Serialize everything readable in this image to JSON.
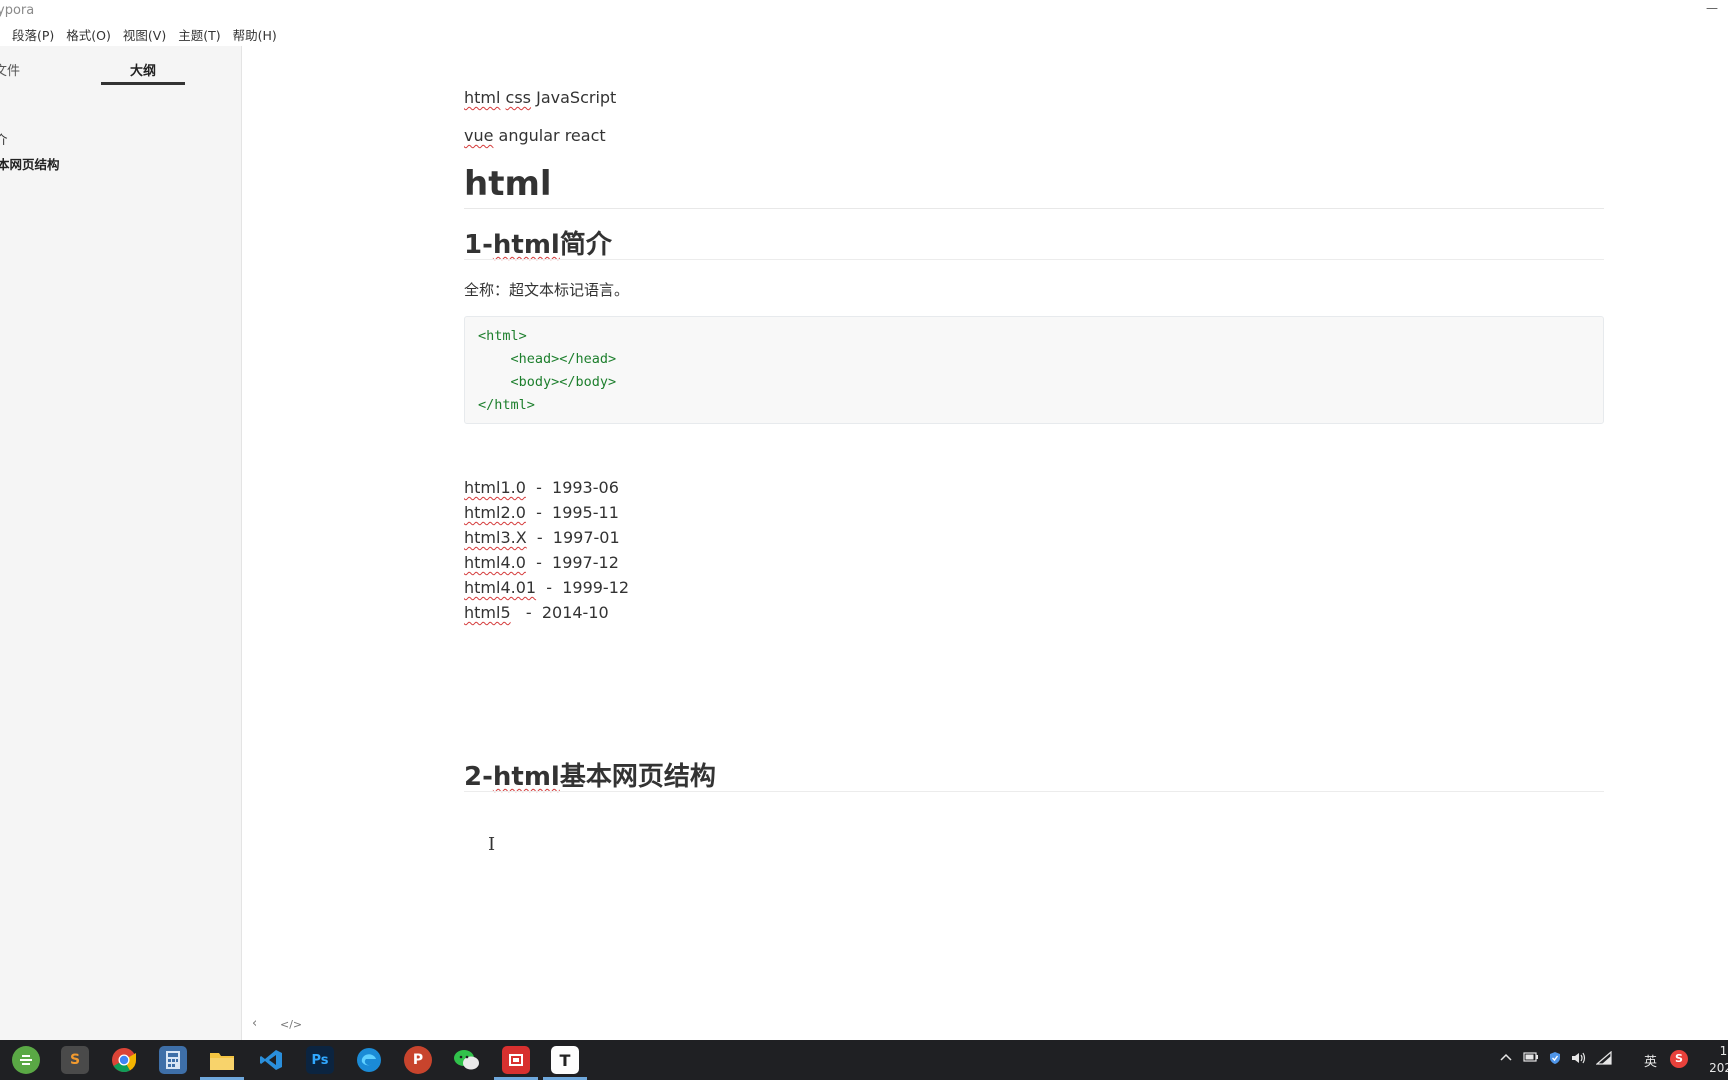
{
  "window": {
    "title": "ypora",
    "minimize": "—"
  },
  "menu": [
    "段落(P)",
    "格式(O)",
    "视图(V)",
    "主题(T)",
    "帮助(H)"
  ],
  "sidebar": {
    "tabs": {
      "files": "文件",
      "outline": "大纲"
    },
    "outline_items": [
      "介",
      "本网页结构"
    ],
    "footer": {
      "back": "‹",
      "source": "</>"
    }
  },
  "editor": {
    "line1": [
      "html",
      "css",
      "JavaScript"
    ],
    "line2": [
      "vue",
      "angular react"
    ],
    "h1": "html",
    "h2_1": {
      "prefix": "1-",
      "word": "html",
      "rest": "简介"
    },
    "para": "全称：超文本标记语言。",
    "code": [
      "<html>",
      "    <head></head>",
      "    <body></body>",
      "</html>"
    ],
    "versions": [
      {
        "name": "html1.0",
        "sep": "  -  ",
        "date": "1993-06"
      },
      {
        "name": "html2.0",
        "sep": "  -  ",
        "date": "1995-11"
      },
      {
        "name": "html3.X",
        "sep": "  -  ",
        "date": "1997-01"
      },
      {
        "name": "html4.0",
        "sep": "  -  ",
        "date": "1997-12"
      },
      {
        "name": "html4.01",
        "sep": "  -  ",
        "date": "1999-12"
      },
      {
        "name": "html5",
        "sep": "   -  ",
        "date": "2014-10"
      }
    ],
    "h2_2": {
      "prefix": "2-",
      "word": "html",
      "rest": "基本网页结构"
    },
    "cursor": "I"
  },
  "taskbar": {
    "apps": [
      "start-app",
      "sublime",
      "chrome",
      "calculator",
      "file-explorer",
      "vscode",
      "photoshop",
      "edge",
      "app-p",
      "wechat",
      "app-red",
      "typora"
    ],
    "labels": {
      "sublime": "S",
      "photoshop": "Ps",
      "app-p": "P",
      "typora": "T"
    },
    "tray": {
      "lang": "英",
      "ime": "S"
    },
    "clock": {
      "time": "1(",
      "date": "202"
    }
  },
  "colors": {
    "accent": "#1d7f2d",
    "taskbar": "#1f2023",
    "sidebar": "#f5f5f5"
  }
}
